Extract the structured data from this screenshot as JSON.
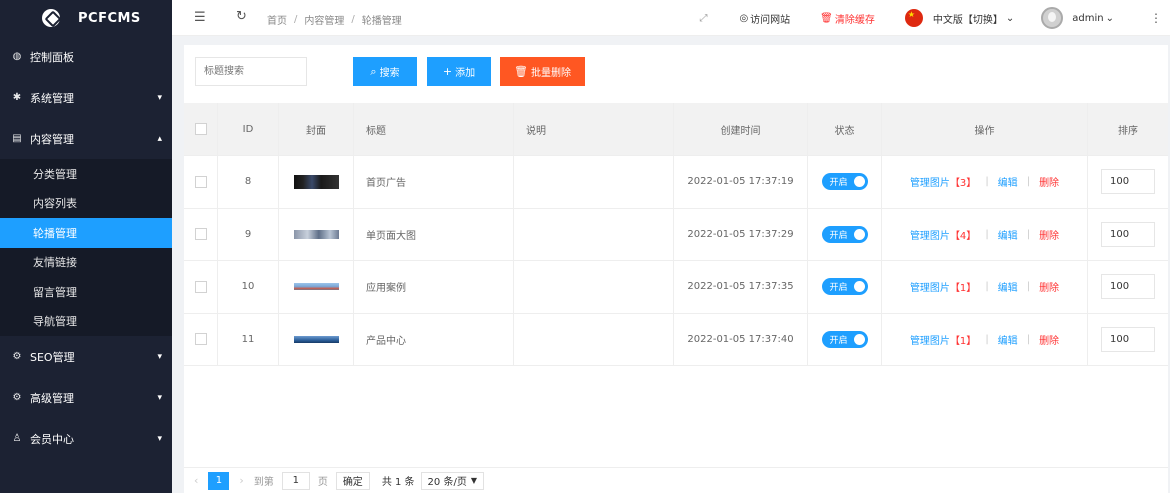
{
  "brand": {
    "name": "PCFCMS"
  },
  "sidebar": {
    "items": [
      {
        "label": "控制面板",
        "icon": "dashboard-icon"
      },
      {
        "label": "系统管理",
        "icon": "gear-icon"
      },
      {
        "label": "内容管理",
        "icon": "content-icon"
      },
      {
        "label": "SEO管理",
        "icon": "seo-icon"
      },
      {
        "label": "高级管理",
        "icon": "advanced-icon"
      },
      {
        "label": "会员中心",
        "icon": "user-icon"
      }
    ],
    "submenu": [
      "分类管理",
      "内容列表",
      "轮播管理",
      "友情链接",
      "留言管理",
      "导航管理"
    ],
    "active_submenu": "轮播管理"
  },
  "header": {
    "breadcrumb": [
      "首页",
      "内容管理",
      "轮播管理"
    ],
    "visit_site": "访问网站",
    "clear_cache": "清除缓存",
    "language": "中文版【切换】",
    "user": "admin"
  },
  "toolbar": {
    "search_placeholder": "标题搜索",
    "search_label": "搜索",
    "add_label": "添加",
    "batch_delete_label": "批量删除"
  },
  "table": {
    "columns": [
      "ID",
      "封面",
      "标题",
      "说明",
      "创建时间",
      "状态",
      "操作",
      "排序"
    ],
    "rows": [
      {
        "id": "8",
        "title": "首页广告",
        "desc": "",
        "time": "2022-01-05 17:37:19",
        "status": "开启",
        "manage": "管理图片",
        "count": "【3】",
        "edit": "编辑",
        "delete": "删除",
        "sort": "100"
      },
      {
        "id": "9",
        "title": "单页面大图",
        "desc": "",
        "time": "2022-01-05 17:37:29",
        "status": "开启",
        "manage": "管理图片",
        "count": "【4】",
        "edit": "编辑",
        "delete": "删除",
        "sort": "100"
      },
      {
        "id": "10",
        "title": "应用案例",
        "desc": "",
        "time": "2022-01-05 17:37:35",
        "status": "开启",
        "manage": "管理图片",
        "count": "【1】",
        "edit": "编辑",
        "delete": "删除",
        "sort": "100"
      },
      {
        "id": "11",
        "title": "产品中心",
        "desc": "",
        "time": "2022-01-05 17:37:40",
        "status": "开启",
        "manage": "管理图片",
        "count": "【1】",
        "edit": "编辑",
        "delete": "删除",
        "sort": "100"
      }
    ]
  },
  "pagination": {
    "current_page": "1",
    "goto_label": "到第",
    "goto_value": "1",
    "page_unit": "页",
    "confirm_label": "确定",
    "total": "共 1 条",
    "page_size": "20 条/页"
  },
  "colors": {
    "accent": "#1e9fff",
    "danger": "#ff5722",
    "sidebar_bg": "#1c2233"
  }
}
